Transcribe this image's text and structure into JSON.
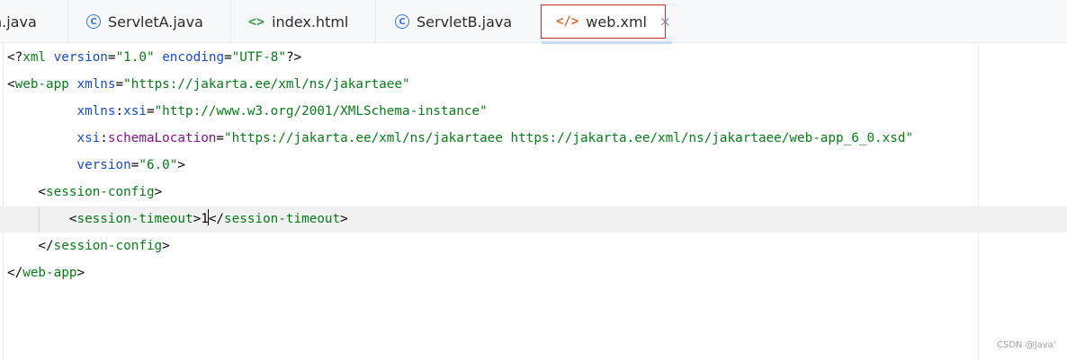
{
  "tabs": [
    {
      "label": "n.java",
      "icon": "java-class-icon",
      "active": false
    },
    {
      "label": "ServletA.java",
      "icon": "java-class-icon",
      "active": false
    },
    {
      "label": "index.html",
      "icon": "html-icon",
      "active": false
    },
    {
      "label": "ServletB.java",
      "icon": "java-class-icon",
      "active": false
    },
    {
      "label": "web.xml",
      "icon": "xml-file-icon",
      "active": true,
      "close": "×"
    }
  ],
  "editor": {
    "lines": [
      {
        "tokens": [
          {
            "t": "<?",
            "c": "pi"
          },
          {
            "t": "xml ",
            "c": "tag"
          },
          {
            "t": "version",
            "c": "xmlattr"
          },
          {
            "t": "=",
            "c": "punct"
          },
          {
            "t": "\"1.0\"",
            "c": "str"
          },
          {
            "t": " ",
            "c": "punct"
          },
          {
            "t": "encoding",
            "c": "xmlattr"
          },
          {
            "t": "=",
            "c": "punct"
          },
          {
            "t": "\"UTF-8\"",
            "c": "str"
          },
          {
            "t": "?>",
            "c": "pi"
          }
        ]
      },
      {
        "tokens": [
          {
            "t": "<",
            "c": "punct"
          },
          {
            "t": "web-app",
            "c": "tag"
          },
          {
            "t": " ",
            "c": "punct"
          },
          {
            "t": "xmlns",
            "c": "attr"
          },
          {
            "t": "=",
            "c": "punct"
          },
          {
            "t": "\"https://jakarta.ee/xml/ns/jakartaee\"",
            "c": "str"
          }
        ]
      },
      {
        "tokens": [
          {
            "t": "         ",
            "c": "punct"
          },
          {
            "t": "xmlns",
            "c": "attr"
          },
          {
            "t": ":",
            "c": "punct"
          },
          {
            "t": "xsi",
            "c": "attr"
          },
          {
            "t": "=",
            "c": "punct"
          },
          {
            "t": "\"http://www.w3.org/2001/XMLSchema-instance\"",
            "c": "str"
          }
        ]
      },
      {
        "tokens": [
          {
            "t": "         ",
            "c": "punct"
          },
          {
            "t": "xsi",
            "c": "attr"
          },
          {
            "t": ":",
            "c": "punct"
          },
          {
            "t": "schemaLocation",
            "c": "attr-local"
          },
          {
            "t": "=",
            "c": "punct"
          },
          {
            "t": "\"https://jakarta.ee/xml/ns/jakartaee https://jakarta.ee/xml/ns/jakartaee/web-app_6_0.xsd\"",
            "c": "str"
          }
        ]
      },
      {
        "tokens": [
          {
            "t": "         ",
            "c": "punct"
          },
          {
            "t": "version",
            "c": "attr"
          },
          {
            "t": "=",
            "c": "punct"
          },
          {
            "t": "\"6.0\"",
            "c": "str"
          },
          {
            "t": ">",
            "c": "punct"
          }
        ]
      },
      {
        "tokens": [
          {
            "t": "    <",
            "c": "punct"
          },
          {
            "t": "session-config",
            "c": "tag"
          },
          {
            "t": ">",
            "c": "punct"
          }
        ]
      },
      {
        "tokens": [
          {
            "t": "        <",
            "c": "punct"
          },
          {
            "t": "session-timeout",
            "c": "tag"
          },
          {
            "t": ">",
            "c": "punct"
          },
          {
            "t": "1",
            "c": "text"
          },
          {
            "t": "</",
            "c": "punct",
            "caret_before": true
          },
          {
            "t": "session-timeout",
            "c": "tag"
          },
          {
            "t": ">",
            "c": "punct"
          }
        ]
      },
      {
        "tokens": [
          {
            "t": "    </",
            "c": "punct"
          },
          {
            "t": "session-config",
            "c": "tag"
          },
          {
            "t": ">",
            "c": "punct"
          }
        ]
      },
      {
        "tokens": [
          {
            "t": "</",
            "c": "punct"
          },
          {
            "t": "web-app",
            "c": "tag"
          },
          {
            "t": ">",
            "c": "punct"
          }
        ]
      }
    ]
  },
  "watermark": "CSDN @Java'"
}
